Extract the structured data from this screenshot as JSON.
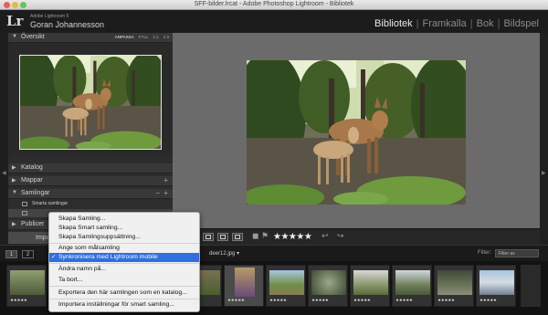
{
  "window": {
    "title": "SFF-bilder.lrcat - Adobe Photoshop Lightroom - Bibliotek"
  },
  "identity": {
    "logo": "Lr",
    "catalog": "Adobe Lightroom 5",
    "user": "Goran Johannesson"
  },
  "modules": [
    {
      "label": "Bibliotek",
      "active": true
    },
    {
      "label": "Framkalla",
      "active": false
    },
    {
      "label": "Bok",
      "active": false
    },
    {
      "label": "Bildspel",
      "active": false
    }
  ],
  "left_panel": {
    "navigator": {
      "title": "Översikt",
      "options": [
        "ANPASSA",
        "FYLL",
        "1:1",
        "1:3"
      ],
      "selected_option": "ANPASSA"
    },
    "catalog": {
      "title": "Katalog"
    },
    "folders": {
      "title": "Mappar",
      "add": "+"
    },
    "collections": {
      "title": "Samlingar",
      "minus": "−",
      "add": "+",
      "smart_collections": "Smarta samlingar"
    },
    "publish": {
      "title": "Publicer"
    },
    "import_button": "Impo"
  },
  "toolbar": {
    "stars": "★★★★★"
  },
  "filmstrip_header": {
    "page1": "1",
    "page2": "2",
    "path": "deer12.jpg ▾",
    "filter_label": "Filter:",
    "filter_value": "Filter av"
  },
  "filmstrip": {
    "thumbs": [
      {
        "stars": "★★★★★",
        "index": ""
      },
      {
        "stars": "",
        "index": ""
      },
      {
        "stars": "",
        "index": ""
      },
      {
        "stars": "",
        "index": ""
      },
      {
        "stars": "★★★★★",
        "index": ""
      },
      {
        "stars": "★★★★★",
        "index": ""
      },
      {
        "stars": "★★★★★",
        "index": ""
      },
      {
        "stars": "★★★★★",
        "index": ""
      },
      {
        "stars": "★★★★★",
        "index": ""
      },
      {
        "stars": "★★★★★",
        "index": ""
      },
      {
        "stars": "★★★★★",
        "index": ""
      },
      {
        "stars": "★★★★★",
        "index": ""
      },
      {
        "stars": "★★★★★",
        "index": ""
      }
    ]
  },
  "context_menu": {
    "items": [
      {
        "label": "Skapa Samling...",
        "checked": false,
        "selected": false
      },
      {
        "label": "Skapa Smart samling...",
        "checked": false,
        "selected": false
      },
      {
        "label": "Skapa Samlingsuppsättning...",
        "checked": false,
        "selected": false
      },
      {
        "label": "Ange som målsamling",
        "checked": false,
        "selected": false
      },
      {
        "label": "Synkronisera med Lightroom mobile",
        "checked": true,
        "selected": true
      },
      {
        "label": "Ändra namn på...",
        "checked": false,
        "selected": false
      },
      {
        "label": "Ta bort...",
        "checked": false,
        "selected": false
      },
      {
        "label": "Exportera den här samlingen som en katalog...",
        "checked": false,
        "selected": false
      },
      {
        "label": "Importera inställningar för smart samling...",
        "checked": false,
        "selected": false
      }
    ]
  },
  "colors": {
    "menu_highlight": "#2f6fe0",
    "panel_bg": "#2d2d2d",
    "loupe_bg": "#6b6b6b"
  }
}
